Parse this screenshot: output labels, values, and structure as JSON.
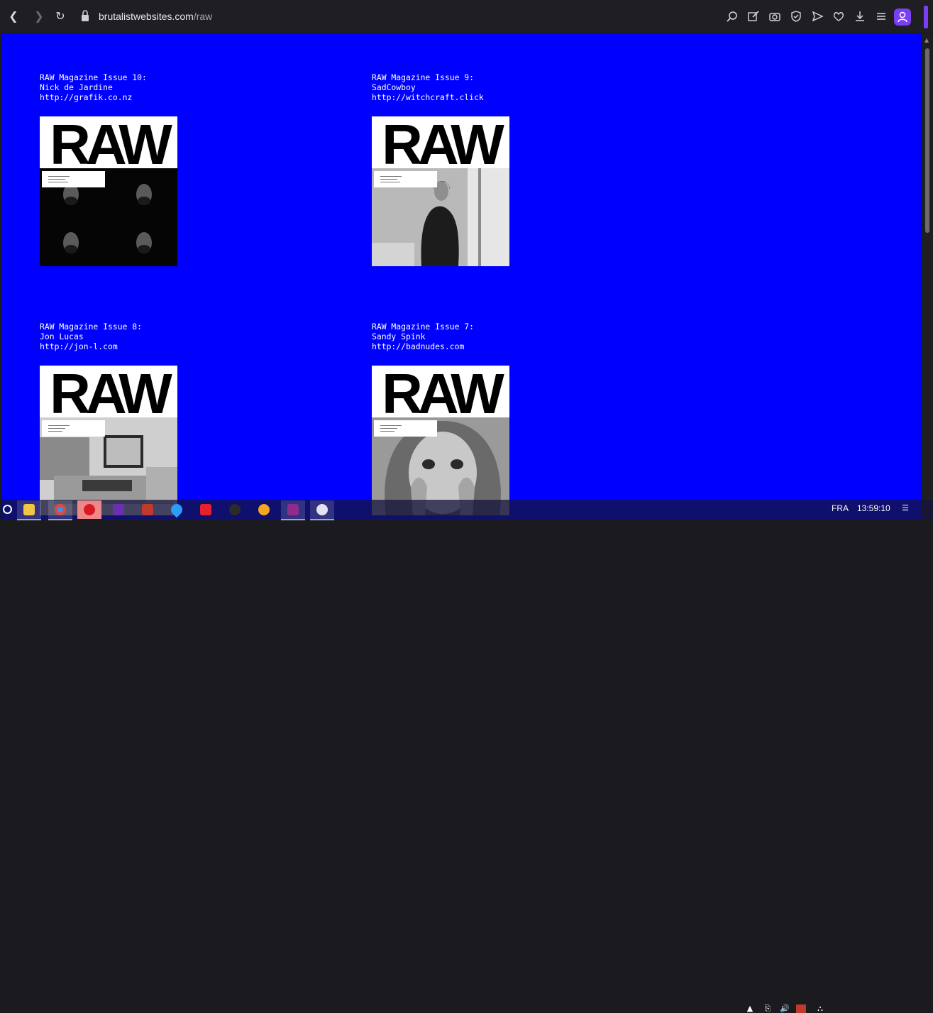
{
  "browser": {
    "url_domain": "brutalistwebsites.com",
    "url_path": "/raw",
    "accent": "#7b3ff2"
  },
  "page": {
    "background": "#0000ff",
    "issues": [
      {
        "heading": "RAW Magazine Issue 10:",
        "name": "Nick de Jardine",
        "link": "http://grafik.co.nz",
        "cover_title": "RAW",
        "photo": "four-portraits"
      },
      {
        "heading": "RAW Magazine Issue 9:",
        "name": "SadCowboy",
        "link": "http://witchcraft.click",
        "cover_title": "RAW",
        "photo": "man-by-window"
      },
      {
        "heading": "RAW Magazine Issue 8:",
        "name": "Jon Lucas",
        "link": "http://jon-l.com",
        "cover_title": "RAW",
        "photo": "computer-desk"
      },
      {
        "heading": "RAW Magazine Issue 7:",
        "name": "Sandy Spink",
        "link": "http://badnudes.com",
        "cover_title": "RAW",
        "photo": "face-closeup"
      }
    ]
  },
  "taskbar": {
    "apps": [
      "search-icon",
      "file-explorer-icon",
      "chrome-icon",
      "opera-icon",
      "app-icon-purple",
      "app-icon-red-blue",
      "drop-icon",
      "wps-icon",
      "spider-icon",
      "shield-browser-icon",
      "winrar-icon",
      "cloud-app-icon"
    ],
    "language": "FRA",
    "time": "13:59:10"
  }
}
